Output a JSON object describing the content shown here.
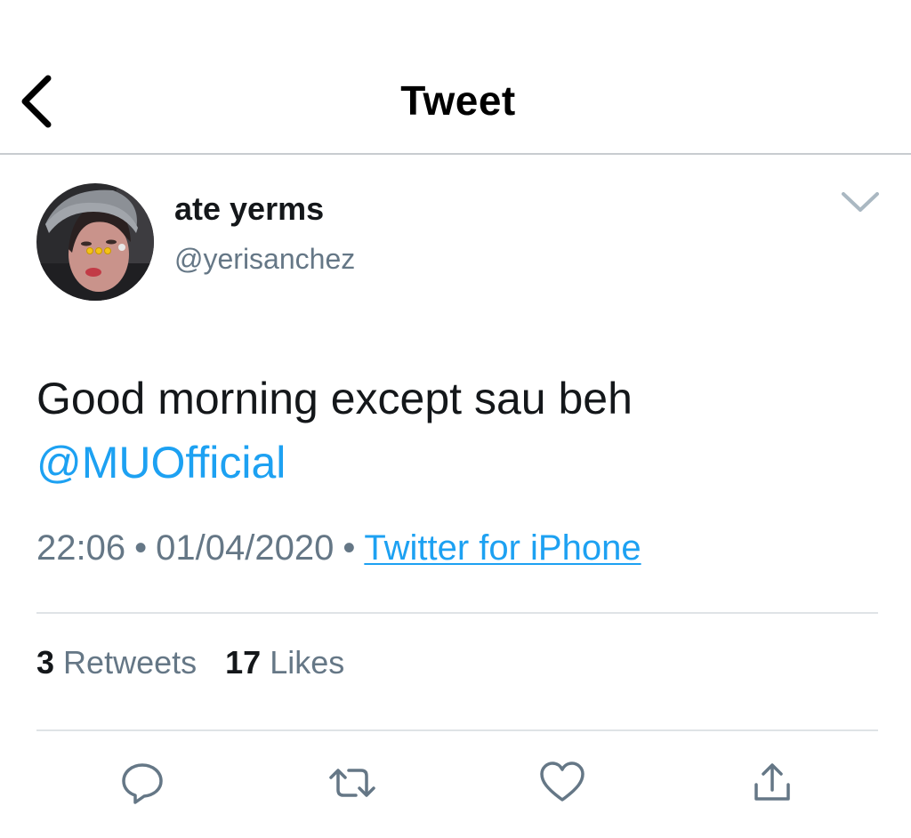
{
  "header": {
    "title": "Tweet",
    "back_icon": "chevron-left-icon"
  },
  "tweet": {
    "author": {
      "display_name": "ate yerms",
      "handle": "@yerisanchez"
    },
    "menu_icon": "chevron-down-icon",
    "text": "Good morning except sau beh",
    "mention": "@MUOfficial",
    "time": "22:06",
    "date": "01/04/2020",
    "separator": "•",
    "source": "Twitter for iPhone"
  },
  "stats": {
    "retweets_count": "3",
    "retweets_label": "Retweets",
    "likes_count": "17",
    "likes_label": "Likes"
  },
  "actions": [
    {
      "name": "reply",
      "icon": "reply-icon"
    },
    {
      "name": "retweet",
      "icon": "retweet-icon"
    },
    {
      "name": "like",
      "icon": "heart-icon"
    },
    {
      "name": "share",
      "icon": "share-icon"
    }
  ],
  "colors": {
    "link": "#1da1f2",
    "secondary_text": "#657786",
    "icon": "#657786",
    "divider": "#dfe3e6"
  }
}
